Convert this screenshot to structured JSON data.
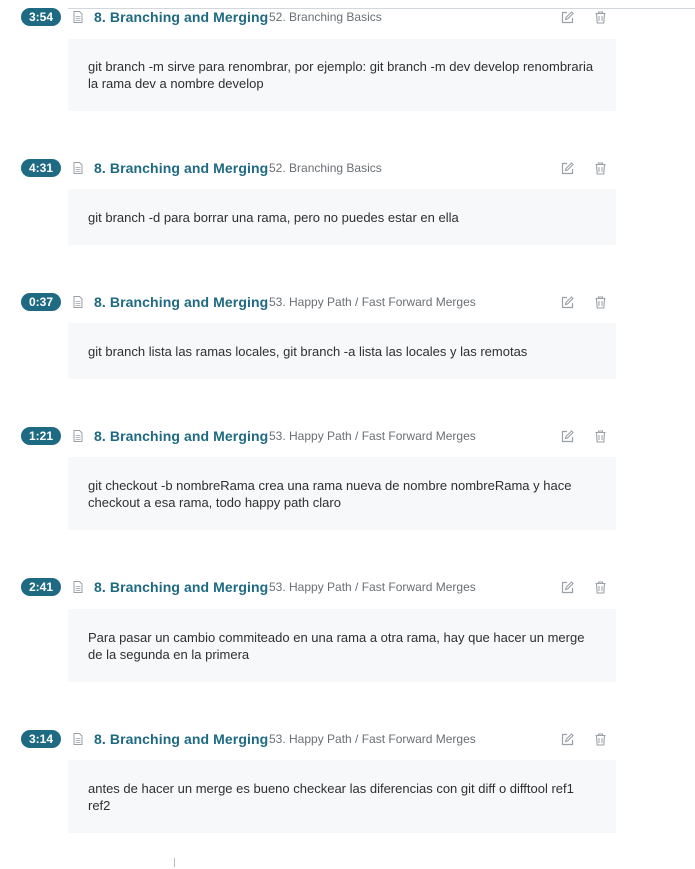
{
  "colors": {
    "accent": "#1e6a82",
    "body_bg": "#f7f8fa",
    "icon": "#9aa0a6"
  },
  "icons": {
    "doc": "doc-icon",
    "edit": "edit-icon",
    "delete": "trash-icon"
  },
  "notes": [
    {
      "timestamp": "3:54",
      "section": "8. Branching and Merging",
      "lecture": "52. Branching Basics",
      "body": "git branch -m sirve para renombrar, por ejemplo: git branch -m dev develop renombraria la rama dev a nombre develop"
    },
    {
      "timestamp": "4:31",
      "section": "8. Branching and Merging",
      "lecture": "52. Branching Basics",
      "body": "git branch -d para borrar una rama, pero no puedes estar en ella"
    },
    {
      "timestamp": "0:37",
      "section": "8. Branching and Merging",
      "lecture": "53. Happy Path / Fast Forward Merges",
      "body": "git branch lista las ramas locales, git branch -a lista las locales y las remotas"
    },
    {
      "timestamp": "1:21",
      "section": "8. Branching and Merging",
      "lecture": "53. Happy Path / Fast Forward Merges",
      "body": "git checkout -b nombreRama crea una rama nueva de nombre nombreRama y hace checkout a esa rama, todo happy path claro"
    },
    {
      "timestamp": "2:41",
      "section": "8. Branching and Merging",
      "lecture": "53. Happy Path / Fast Forward Merges",
      "body": "Para pasar un cambio commiteado en una rama a otra rama, hay que hacer un merge de la segunda en la primera"
    },
    {
      "timestamp": "3:14",
      "section": "8. Branching and Merging",
      "lecture": "53. Happy Path / Fast Forward Merges",
      "body": "antes de hacer un merge es bueno checkear las diferencias con git diff o difftool ref1 ref2"
    }
  ]
}
